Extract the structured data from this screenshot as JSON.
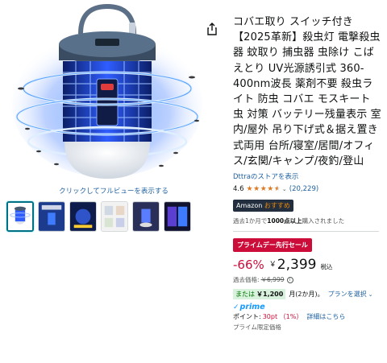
{
  "gallery": {
    "zoom_hint": "クリックしてフルビューを表示する",
    "thumbnail_count": 6,
    "selected_index": 0,
    "icons": {
      "share": "share-icon"
    }
  },
  "product": {
    "title": "コバエ取り スイッチ付き【2025革新】殺虫灯 電撃殺虫器 蚊取り 捕虫器 虫除け こばえとり UV光源誘引式 360-400nm波長 薬剤不要 殺虫ライト 防虫 コバエ モスキート 虫 対策 バッテリー残量表示 室内/屋外 吊り下げ式＆据え置き式両用 台所/寝室/居間/オフィス/玄関/キャンプ/夜釣/登山",
    "store_link": "Dttraのストアを表示",
    "rating": "4.6",
    "rating_value": 4.6,
    "review_count": "(20,229)",
    "badge_prefix": "Amazon",
    "badge_suffix": "おすすめ",
    "bought_prefix": "過去1か月で",
    "bought_count": "1000点以上",
    "bought_suffix": "購入されました"
  },
  "pricing": {
    "deal_badge": "プライムデー先行セール",
    "discount": "-66%",
    "currency": "￥",
    "price": "2,399",
    "tax_label": "税込",
    "list_price_label": "過去価格:",
    "list_price": "￥6,999",
    "installment_prefix": "または",
    "installment_amount": "￥1,200",
    "installment_months": "月(2か月)。",
    "plan_link": "プランを選択",
    "prime": "prime",
    "points_label": "ポイント:",
    "points_value": "30pt （1%）",
    "points_link": "詳細はこちら",
    "exclusive_price": "プライム限定価格"
  },
  "colors": {
    "link": "#2162a1",
    "deal_red": "#cc0c39",
    "star": "#de7921",
    "prime_blue": "#1399ff",
    "badge_dark": "#232f3e",
    "uv_blue": "#3f6bff"
  }
}
